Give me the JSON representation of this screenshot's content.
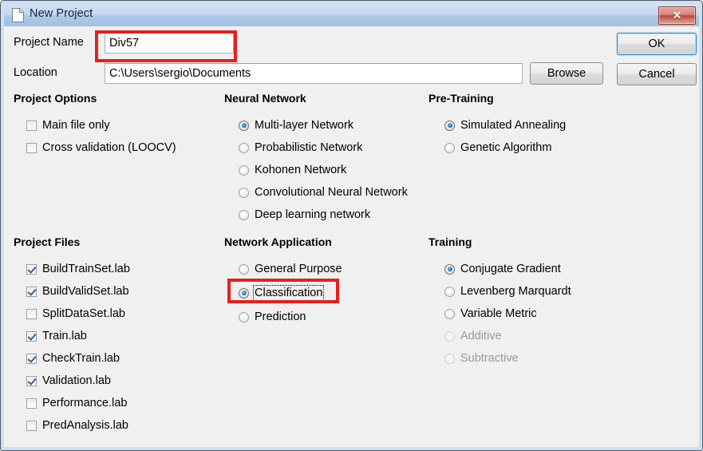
{
  "window": {
    "title": "New Project",
    "icon": "document-icon",
    "close_label": "✕"
  },
  "form": {
    "project_name_label": "Project Name",
    "project_name_value": "Div57",
    "project_name_placeholder": "",
    "location_label": "Location",
    "location_value": "C:\\Users\\sergio\\Documents",
    "location_placeholder": "",
    "browse_label": "Browse",
    "ok_label": "OK",
    "cancel_label": "Cancel"
  },
  "project_options": {
    "heading": "Project Options",
    "items": [
      {
        "label": "Main file only",
        "checked": false
      },
      {
        "label": "Cross validation (LOOCV)",
        "checked": false
      }
    ]
  },
  "neural_network": {
    "heading": "Neural Network",
    "items": [
      {
        "label": "Multi-layer Network",
        "selected": true
      },
      {
        "label": "Probabilistic Network",
        "selected": false
      },
      {
        "label": "Kohonen Network",
        "selected": false
      },
      {
        "label": "Convolutional Neural Network",
        "selected": false
      },
      {
        "label": "Deep learning network",
        "selected": false
      }
    ]
  },
  "pre_training": {
    "heading": "Pre-Training",
    "items": [
      {
        "label": "Simulated Annealing",
        "selected": true
      },
      {
        "label": "Genetic Algorithm",
        "selected": false
      }
    ]
  },
  "project_files": {
    "heading": "Project Files",
    "items": [
      {
        "label": "BuildTrainSet.lab",
        "checked": true
      },
      {
        "label": "BuildValidSet.lab",
        "checked": true
      },
      {
        "label": "SplitDataSet.lab",
        "checked": false
      },
      {
        "label": "Train.lab",
        "checked": true
      },
      {
        "label": "CheckTrain.lab",
        "checked": true
      },
      {
        "label": "Validation.lab",
        "checked": true
      },
      {
        "label": "Performance.lab",
        "checked": false
      },
      {
        "label": "PredAnalysis.lab",
        "checked": false
      }
    ]
  },
  "network_application": {
    "heading": "Network Application",
    "items": [
      {
        "label": "General Purpose",
        "selected": false,
        "focused": false
      },
      {
        "label": "Classification",
        "selected": true,
        "focused": true
      },
      {
        "label": "Prediction",
        "selected": false,
        "focused": false
      }
    ]
  },
  "training": {
    "heading": "Training",
    "items": [
      {
        "label": "Conjugate Gradient",
        "selected": true,
        "disabled": false
      },
      {
        "label": "Levenberg Marquardt",
        "selected": false,
        "disabled": false
      },
      {
        "label": "Variable Metric",
        "selected": false,
        "disabled": false
      },
      {
        "label": "Additive",
        "selected": false,
        "disabled": true
      },
      {
        "label": "Subtractive",
        "selected": false,
        "disabled": true
      }
    ]
  },
  "annotations": {
    "accent_color": "#e8201c",
    "highlighted": [
      "project-name-input",
      "radio-classification"
    ]
  }
}
